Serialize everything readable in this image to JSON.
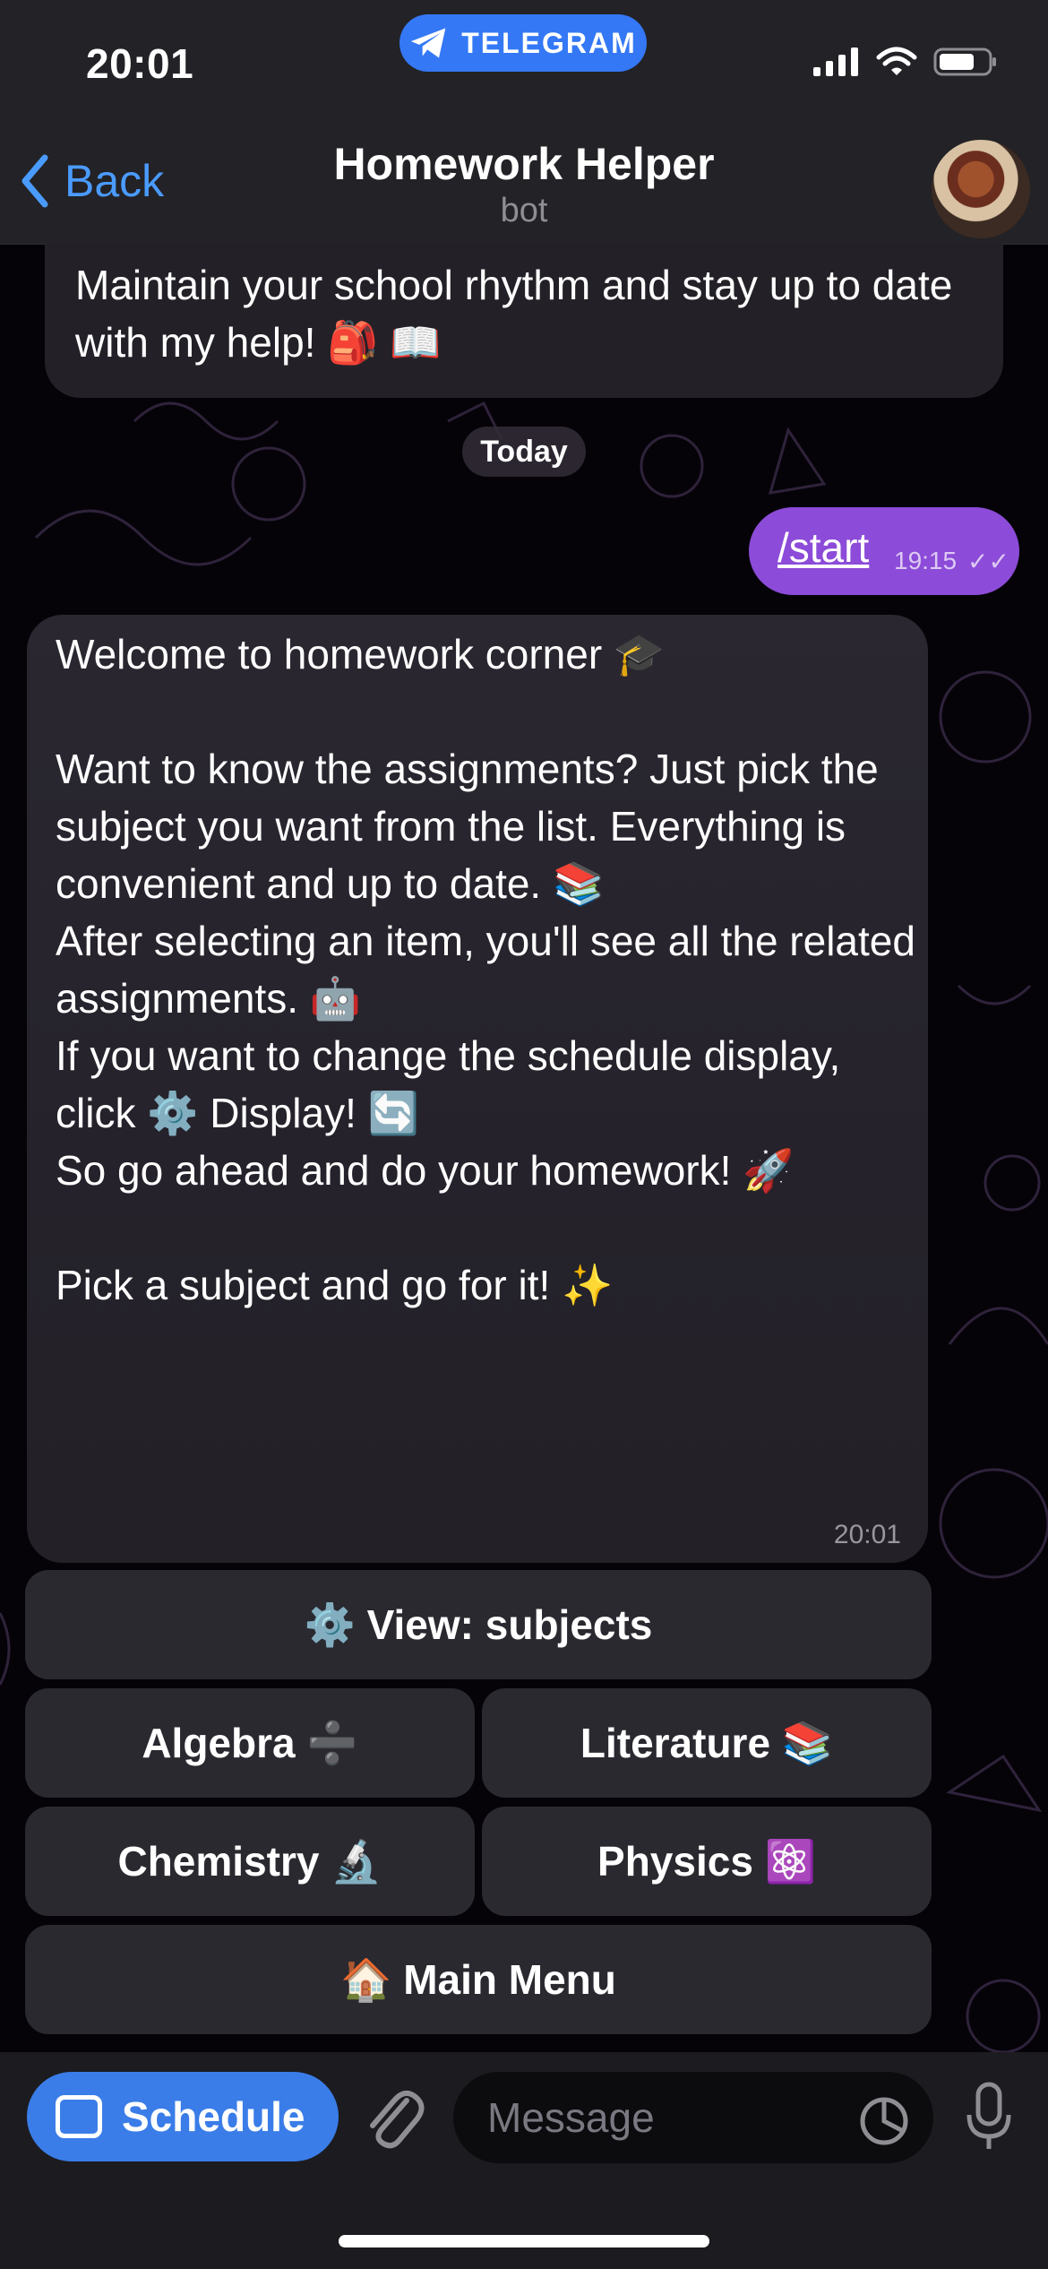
{
  "status_bar": {
    "time": "20:01",
    "app_pill": "TELEGRAM"
  },
  "header": {
    "back_label": "Back",
    "title": "Homework Helper",
    "subtitle": "bot",
    "back_icon": "chevron-left-icon"
  },
  "messages": {
    "previous_text": "Maintain your school rhythm and stay up to date with my help! 🎒 📖",
    "date_separator": "Today",
    "outgoing": {
      "text": "/start",
      "time": "19:15",
      "status": "✓✓"
    },
    "bot_reply": {
      "paragraphs": [
        "Welcome to homework corner 🎓",
        "Want to know the assignments? Just pick the subject you want from the list. Everything is convenient and up to date. 📚",
        "After selecting an item, you'll see all the related assignments. 🤖",
        "If you want to change the schedule display, click ⚙️ Display! 🔄",
        "So go ahead and do your homework! 🚀",
        "Pick a subject and go for it! ✨"
      ],
      "time": "20:01"
    }
  },
  "keyboard": {
    "view_subjects": "⚙️ View: subjects",
    "algebra": "Algebra ➗",
    "literature": "Literature 📚",
    "chemistry": "Chemistry 🔬",
    "physics": "Physics ⚛️",
    "main_menu": "🏠 Main Menu"
  },
  "input_bar": {
    "schedule_label": "Schedule",
    "message_placeholder": "Message"
  },
  "colors": {
    "accent_blue": "#3478f6",
    "outgoing_bubble": "#8c4bd8",
    "incoming_bubble": "#232127",
    "header_bg": "#232226"
  }
}
